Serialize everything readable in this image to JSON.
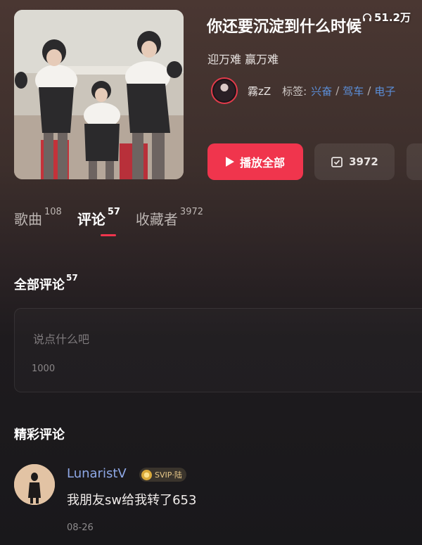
{
  "playlist": {
    "play_count": "51.2万",
    "title": "你还要沉淀到什么时候",
    "subtitle": "迎万难 赢万难",
    "creator_name": "霧zZ",
    "tags_label": "标签:",
    "tags": [
      "兴奋",
      "驾车",
      "电子"
    ]
  },
  "actions": {
    "play_all_label": "播放全部",
    "collect_count": "3972"
  },
  "tabs": [
    {
      "label": "歌曲",
      "count": "108"
    },
    {
      "label": "评论",
      "count": "57"
    },
    {
      "label": "收藏者",
      "count": "3972"
    }
  ],
  "comments": {
    "all_title": "全部评论",
    "all_count": "57",
    "input_placeholder": "说点什么吧",
    "char_limit": "1000",
    "featured_title": "精彩评论",
    "items": [
      {
        "user": "LunaristV",
        "badge": "SVIP·陆",
        "text": "我朋友sw给我转了653",
        "date": "08-26"
      }
    ]
  },
  "colors": {
    "accent": "#f0354d",
    "tag_link": "#5b8fd9",
    "username": "#8ea8e6"
  }
}
